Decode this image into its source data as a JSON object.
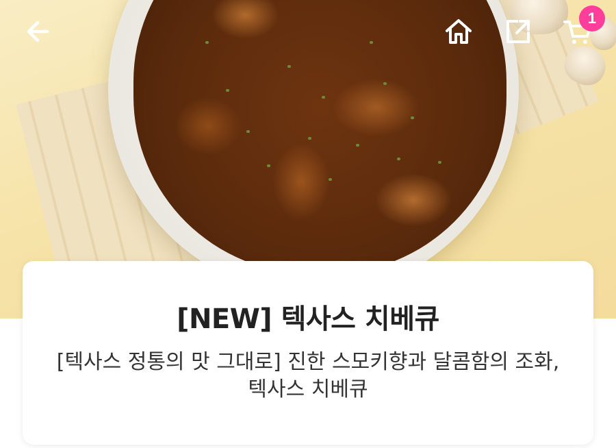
{
  "header": {
    "back_icon": "arrow-left-icon",
    "home_icon": "home-icon",
    "share_icon": "share-icon",
    "cart_icon": "cart-icon",
    "cart_count": "1",
    "badge_color": "#ff3d9a"
  },
  "product": {
    "title": "[NEW] 텍사스 치베큐",
    "description": "[텍사스 정통의 맛 그대로] 진한 스모키향과 달콤함의 조화, 텍사스 치베큐"
  },
  "colors": {
    "background": "#ffffff",
    "hero_bg": "#f6e3a8",
    "title_text": "#222222",
    "body_text": "#333333"
  }
}
